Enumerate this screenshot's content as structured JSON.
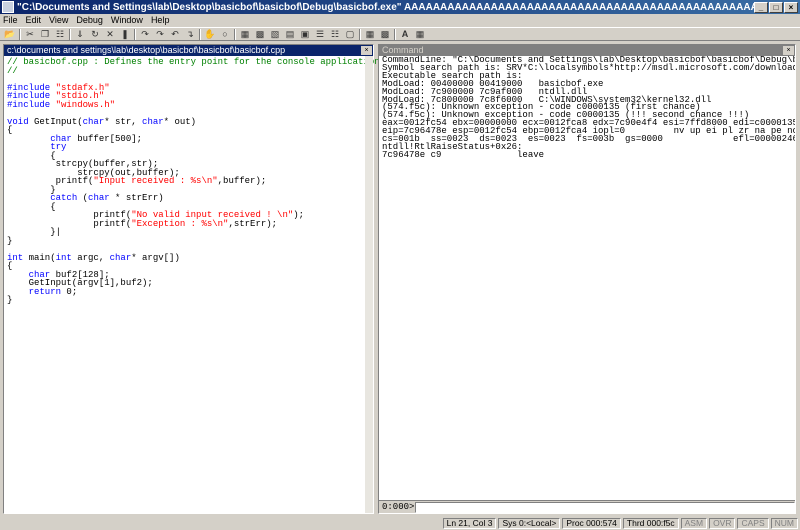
{
  "window": {
    "title": "\"C:\\Documents and Settings\\lab\\Desktop\\basicbof\\basicbof\\Debug\\basicbof.exe\" AAAAAAAAAAAAAAAAAAAAAAAAAAAAAAAAAAAAAAAAAAAAAAAAAAAAAAAAAAAAAAAAAAAAAAAAAAAAAAAAAAAAAAAAAAAAAAAAAAAAAAA"
  },
  "menu": [
    "File",
    "Edit",
    "View",
    "Debug",
    "Window",
    "Help"
  ],
  "source_pane": {
    "title": "c:\\documents and settings\\lab\\desktop\\basicbof\\basicbof\\basicbof.cpp"
  },
  "command_pane": {
    "title": "Command",
    "prompt": "0:000>",
    "input_value": "",
    "output": [
      "CommandLine: \"C:\\Documents and Settings\\lab\\Desktop\\basicbof\\basicbof\\Debug\\basicbof.e",
      "Symbol search path is: SRV*C:\\localsymbols*http://msdl.microsoft.com/download/symbols",
      "Executable search path is:",
      "ModLoad: 00400000 00419000   basicbof.exe",
      "ModLoad: 7c900000 7c9af000   ntdll.dll",
      "ModLoad: 7c800000 7c8f6000   C:\\WINDOWS\\system32\\kernel32.dll",
      "(574.f5c): Unknown exception - code c0000135 (first chance)",
      "(574.f5c): Unknown exception - code c0000135 (!!! second chance !!!)",
      "eax=0012fc54 ebx=00000000 ecx=0012fca8 edx=7c90e4f4 esi=7ffd8000 edi=c0000135",
      "eip=7c96478e esp=0012fc54 ebp=0012fca4 iopl=0         nv up ei pl zr na pe nc",
      "cs=001b  ss=0023  ds=0023  es=0023  fs=003b  gs=0000             efl=00000246",
      "ntdll!RtlRaiseStatus+0x26:",
      "7c96478e c9              leave"
    ]
  },
  "code_lines": [
    [
      {
        "t": "// basicbof.cpp : Defines the entry point for the console application.",
        "c": "comment"
      }
    ],
    [
      {
        "t": "//",
        "c": "comment"
      }
    ],
    [
      {
        "t": "",
        "c": "txt"
      }
    ],
    [
      {
        "t": "#include ",
        "c": "pp"
      },
      {
        "t": "\"stdafx.h\"",
        "c": "str"
      }
    ],
    [
      {
        "t": "#include ",
        "c": "pp"
      },
      {
        "t": "\"stdio.h\"",
        "c": "str"
      }
    ],
    [
      {
        "t": "#include ",
        "c": "pp"
      },
      {
        "t": "\"windows.h\"",
        "c": "str"
      }
    ],
    [
      {
        "t": "",
        "c": "txt"
      }
    ],
    [
      {
        "t": "void",
        "c": "kw"
      },
      {
        "t": " GetInput(",
        "c": "txt"
      },
      {
        "t": "char",
        "c": "kw"
      },
      {
        "t": "* str, ",
        "c": "txt"
      },
      {
        "t": "char",
        "c": "kw"
      },
      {
        "t": "* out)",
        "c": "txt"
      }
    ],
    [
      {
        "t": "{",
        "c": "txt"
      }
    ],
    [
      {
        "t": "        ",
        "c": "txt"
      },
      {
        "t": "char",
        "c": "kw"
      },
      {
        "t": " buffer[500];",
        "c": "txt"
      }
    ],
    [
      {
        "t": "        ",
        "c": "txt"
      },
      {
        "t": "try",
        "c": "kw"
      }
    ],
    [
      {
        "t": "        {",
        "c": "txt"
      }
    ],
    [
      {
        "t": "         strcpy(buffer,str);",
        "c": "txt"
      }
    ],
    [
      {
        "t": "             strcpy(out,buffer);",
        "c": "txt"
      }
    ],
    [
      {
        "t": "         printf(",
        "c": "txt"
      },
      {
        "t": "\"Input received : %s\\n\"",
        "c": "str"
      },
      {
        "t": ",buffer);",
        "c": "txt"
      }
    ],
    [
      {
        "t": "        }",
        "c": "txt"
      }
    ],
    [
      {
        "t": "        ",
        "c": "txt"
      },
      {
        "t": "catch",
        "c": "kw"
      },
      {
        "t": " (",
        "c": "txt"
      },
      {
        "t": "char",
        "c": "kw"
      },
      {
        "t": " * strErr)",
        "c": "txt"
      }
    ],
    [
      {
        "t": "        {",
        "c": "txt"
      }
    ],
    [
      {
        "t": "                printf(",
        "c": "txt"
      },
      {
        "t": "\"No valid input received ! \\n\"",
        "c": "str"
      },
      {
        "t": ");",
        "c": "txt"
      }
    ],
    [
      {
        "t": "                printf(",
        "c": "txt"
      },
      {
        "t": "\"Exception : %s\\n\"",
        "c": "str"
      },
      {
        "t": ",strErr);",
        "c": "txt"
      }
    ],
    [
      {
        "t": "        }|",
        "c": "txt"
      }
    ],
    [
      {
        "t": "}",
        "c": "txt"
      }
    ],
    [
      {
        "t": "",
        "c": "txt"
      }
    ],
    [
      {
        "t": "int",
        "c": "kw"
      },
      {
        "t": " main(",
        "c": "txt"
      },
      {
        "t": "int",
        "c": "kw"
      },
      {
        "t": " argc, ",
        "c": "txt"
      },
      {
        "t": "char",
        "c": "kw"
      },
      {
        "t": "* argv[])",
        "c": "txt"
      }
    ],
    [
      {
        "t": "{",
        "c": "txt"
      }
    ],
    [
      {
        "t": "    ",
        "c": "txt"
      },
      {
        "t": "char",
        "c": "kw"
      },
      {
        "t": " buf2[128];",
        "c": "txt"
      }
    ],
    [
      {
        "t": "    GetInput(argv[1],buf2);",
        "c": "txt"
      }
    ],
    [
      {
        "t": "    ",
        "c": "txt"
      },
      {
        "t": "return",
        "c": "kw"
      },
      {
        "t": " 0;",
        "c": "txt"
      }
    ],
    [
      {
        "t": "}",
        "c": "txt"
      }
    ]
  ],
  "status": {
    "position": "Ln 21, Col 3",
    "system": "Sys 0:<Local>",
    "process": "Proc 000:574",
    "thread": "Thrd 000:f5c",
    "asm": "ASM",
    "ovr": "OVR",
    "caps": "CAPS",
    "num": "NUM"
  },
  "colors": {
    "comment": "#008000",
    "keyword": "#0000ff",
    "string": "#ff0000",
    "active_title": "#0a246a"
  }
}
